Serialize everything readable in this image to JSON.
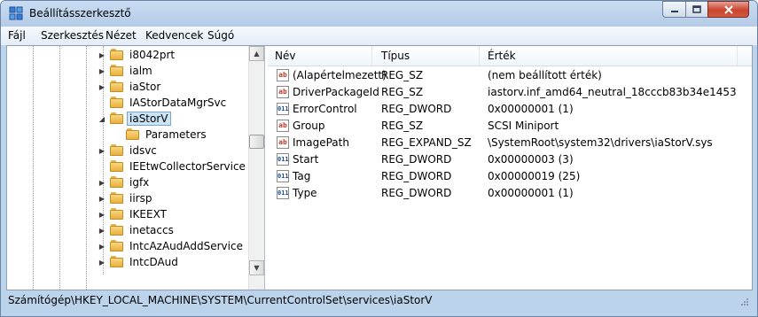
{
  "window": {
    "title": "Beállításszerkesztő"
  },
  "menu": [
    "Fájl",
    "Szerkesztés",
    "Nézet",
    "Kedvencek",
    "Súgó"
  ],
  "tree": {
    "items": [
      {
        "label": "i8042prt",
        "level": 1,
        "expandable": true,
        "selected": false
      },
      {
        "label": "ialm",
        "level": 1,
        "expandable": true,
        "selected": false
      },
      {
        "label": "iaStor",
        "level": 1,
        "expandable": true,
        "selected": false
      },
      {
        "label": "IAStorDataMgrSvc",
        "level": 1,
        "expandable": false,
        "selected": false
      },
      {
        "label": "iaStorV",
        "level": 1,
        "expandable": true,
        "expanded": true,
        "selected": true
      },
      {
        "label": "Parameters",
        "level": 2,
        "expandable": false,
        "selected": false
      },
      {
        "label": "idsvc",
        "level": 1,
        "expandable": true,
        "selected": false
      },
      {
        "label": "IEEtwCollectorService",
        "level": 1,
        "expandable": false,
        "selected": false
      },
      {
        "label": "igfx",
        "level": 1,
        "expandable": true,
        "selected": false
      },
      {
        "label": "iirsp",
        "level": 1,
        "expandable": true,
        "selected": false
      },
      {
        "label": "IKEEXT",
        "level": 1,
        "expandable": true,
        "selected": false
      },
      {
        "label": "inetaccs",
        "level": 1,
        "expandable": true,
        "selected": false
      },
      {
        "label": "IntcAzAudAddService",
        "level": 1,
        "expandable": true,
        "selected": false
      },
      {
        "label": "IntcDAud",
        "level": 1,
        "expandable": true,
        "selected": false
      }
    ]
  },
  "list": {
    "columns": [
      "Név",
      "Típus",
      "Érték"
    ],
    "rows": [
      {
        "icon": "string-value-icon",
        "name": "(Alapértelmezett)",
        "type": "REG_SZ",
        "value": "(nem beállított érték)"
      },
      {
        "icon": "string-value-icon",
        "name": "DriverPackageId",
        "type": "REG_SZ",
        "value": "iastorv.inf_amd64_neutral_18cccb83b34e1453"
      },
      {
        "icon": "dword-value-icon",
        "name": "ErrorControl",
        "type": "REG_DWORD",
        "value": "0x00000001 (1)"
      },
      {
        "icon": "string-value-icon",
        "name": "Group",
        "type": "REG_SZ",
        "value": "SCSI Miniport"
      },
      {
        "icon": "string-value-icon",
        "name": "ImagePath",
        "type": "REG_EXPAND_SZ",
        "value": "\\SystemRoot\\system32\\drivers\\iaStorV.sys"
      },
      {
        "icon": "dword-value-icon",
        "name": "Start",
        "type": "REG_DWORD",
        "value": "0x00000003 (3)"
      },
      {
        "icon": "dword-value-icon",
        "name": "Tag",
        "type": "REG_DWORD",
        "value": "0x00000019 (25)"
      },
      {
        "icon": "dword-value-icon",
        "name": "Type",
        "type": "REG_DWORD",
        "value": "0x00000001 (1)"
      }
    ]
  },
  "statusbar": {
    "path": "Számítógép\\HKEY_LOCAL_MACHINE\\SYSTEM\\CurrentControlSet\\services\\iaStorV"
  },
  "icon_glyphs": {
    "string": "ab",
    "dword": "011"
  }
}
